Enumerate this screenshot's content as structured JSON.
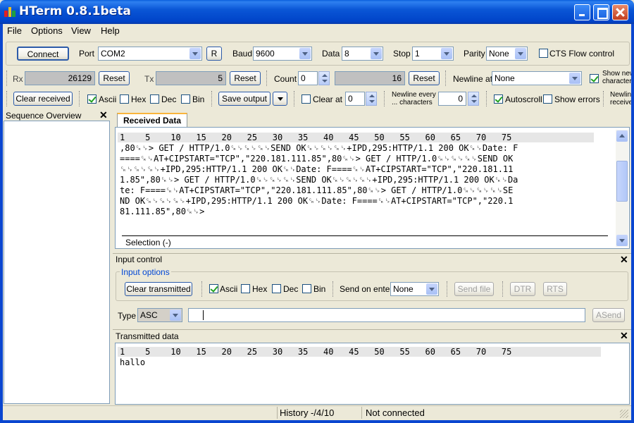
{
  "window": {
    "title": "HTerm 0.8.1beta"
  },
  "menu": [
    "File",
    "Options",
    "View",
    "Help"
  ],
  "toolbar1": {
    "connect": "Connect",
    "port_label": "Port",
    "port_value": "COM2",
    "refresh": "R",
    "baud_label": "Baud",
    "baud_value": "9600",
    "data_label": "Data",
    "data_value": "8",
    "stop_label": "Stop",
    "stop_value": "1",
    "parity_label": "Parity",
    "parity_value": "None",
    "cts_label": "CTS Flow control"
  },
  "toolbar2": {
    "rx_label": "Rx",
    "rx_value": "26129",
    "reset": "Reset",
    "tx_label": "Tx",
    "tx_value": "5",
    "count_label": "Count",
    "count_value": "0",
    "count_total": "16",
    "newline_label": "Newline at",
    "newline_value": "None",
    "show_newline_1": "Show new",
    "show_newline_2": "characters"
  },
  "toolbar3": {
    "clear_received": "Clear received",
    "ascii": "Ascii",
    "hex": "Hex",
    "dec": "Dec",
    "bin": "Bin",
    "save_output": "Save output",
    "clear_at": "Clear at",
    "clear_at_value": "0",
    "newline_every_1": "Newline every",
    "newline_every_2": "... characters",
    "newline_every_value": "0",
    "autoscroll": "Autoscroll",
    "show_errors": "Show errors",
    "newline_recv_1": "Newlin",
    "newline_recv_2": "receive"
  },
  "sequence": {
    "title": "Sequence Overview"
  },
  "received": {
    "tab": "Received Data",
    "ruler": "1    5    10   15   20   25   30   35   40   45   50   55   60   65   70   75",
    "lines": [
      ",80␍␊> GET / HTTP/1.0␍␊␍␊␍␊SEND OK␍␊␍␊␍␊+IPD,295:HTTP/1.1 200 OK␍␊Date: F",
      "====␍␊AT+CIPSTART=\"TCP\",\"220.181.111.85\",80␍␊> GET / HTTP/1.0␍␊␍␊␍␊SEND OK",
      "␍␊␍␊␍␊+IPD,295:HTTP/1.1 200 OK␍␊Date: F====␍␊AT+CIPSTART=\"TCP\",\"220.181.11",
      "1.85\",80␍␊> GET / HTTP/1.0␍␊␍␊␍␊SEND OK␍␊␍␊␍␊+IPD,295:HTTP/1.1 200 OK␍␊Da",
      "te: F====␍␊AT+CIPSTART=\"TCP\",\"220.181.111.85\",80␍␊> GET / HTTP/1.0␍␊␍␊␍␊SE",
      "ND OK␍␊␍␊␍␊+IPD,295:HTTP/1.1 200 OK␍␊Date: F====␍␊AT+CIPSTART=\"TCP\",\"220.1",
      "81.111.85\",80␍␊>"
    ],
    "selection": "Selection (-)"
  },
  "input_control": {
    "title": "Input control",
    "options_label": "Input options",
    "clear_transmitted": "Clear transmitted",
    "ascii": "Ascii",
    "hex": "Hex",
    "dec": "Dec",
    "bin": "Bin",
    "send_on_enter": "Send on enter",
    "send_on_enter_value": "None",
    "send_file": "Send file",
    "dtr": "DTR",
    "rts": "RTS",
    "type_label": "Type",
    "type_value": "ASC",
    "input_value": "",
    "asend": "ASend"
  },
  "transmitted": {
    "title": "Transmitted data",
    "ruler": "1    5    10   15   20   25   30   35   40   45   50   55   60   65   70   75",
    "text": "hallo"
  },
  "status": {
    "history": "History -/4/10",
    "connection": "Not connected"
  }
}
